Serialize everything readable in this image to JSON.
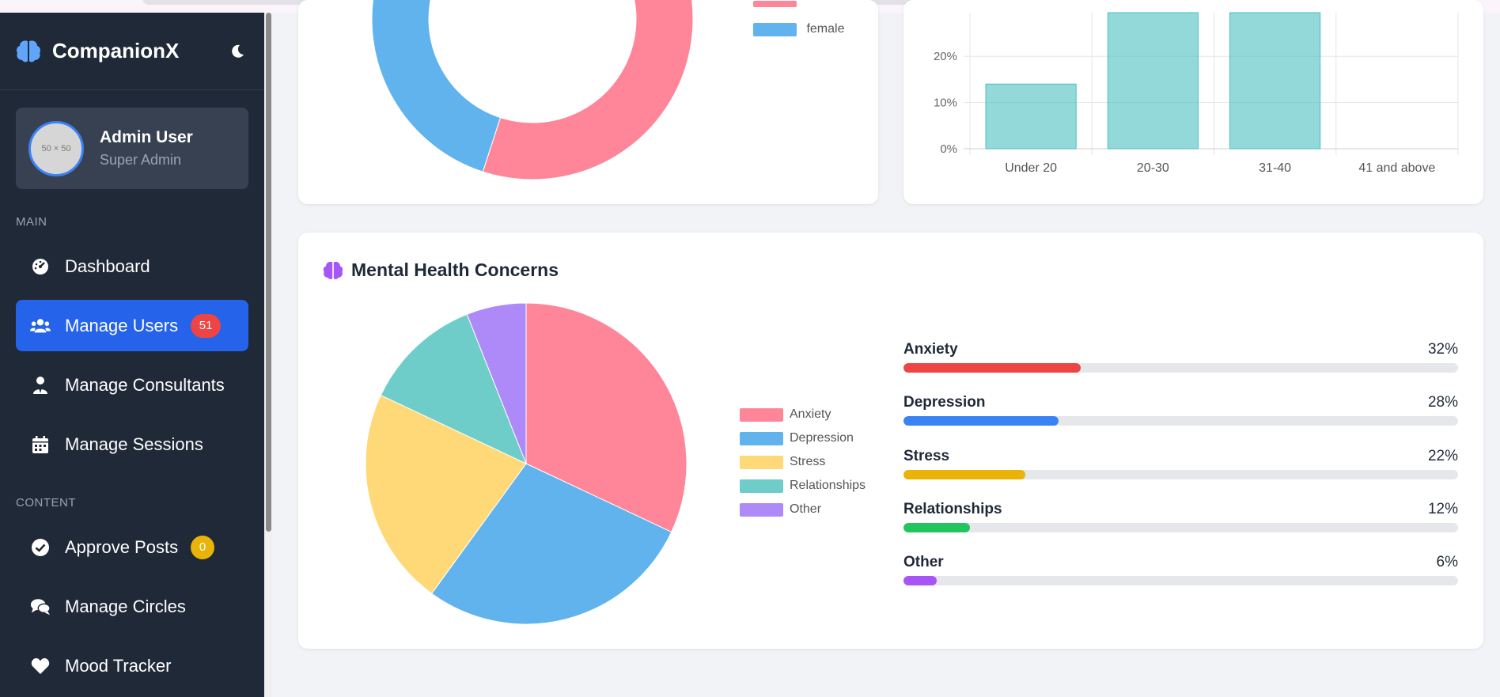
{
  "brand": {
    "name": "CompanionX"
  },
  "profile": {
    "avatar_text": "50 × 50",
    "name": "Admin User",
    "role": "Super Admin"
  },
  "sidebar": {
    "sections": [
      {
        "label": "MAIN"
      },
      {
        "label": "CONTENT"
      }
    ],
    "items": [
      {
        "label": "Dashboard",
        "icon": "tachometer-icon"
      },
      {
        "label": "Manage Users",
        "icon": "users-icon",
        "badge": "51",
        "active": true
      },
      {
        "label": "Manage Consultants",
        "icon": "user-tie-icon"
      },
      {
        "label": "Manage Sessions",
        "icon": "calendar-icon"
      },
      {
        "label": "Approve Posts",
        "icon": "check-circle-icon",
        "badge": "0"
      },
      {
        "label": "Manage Circles",
        "icon": "comments-icon"
      },
      {
        "label": "Mood Tracker",
        "icon": "heart-icon"
      }
    ]
  },
  "gender_chart": {
    "legend": [
      {
        "label": "female",
        "color": "#60b3ec"
      }
    ],
    "colors": {
      "male": "#ff8599",
      "female": "#60b3ec"
    }
  },
  "age_chart": {
    "y_ticks": [
      "0%",
      "10%",
      "20%"
    ],
    "categories": [
      "Under 20",
      "20-30",
      "31-40",
      "41 and above"
    ]
  },
  "concerns": {
    "title": "Mental Health Concerns",
    "items": [
      {
        "label": "Anxiety",
        "percent_text": "32%",
        "value": 32,
        "bar_color": "#ef4444",
        "pie_color": "#ff8599"
      },
      {
        "label": "Depression",
        "percent_text": "28%",
        "value": 28,
        "bar_color": "#3b82f6",
        "pie_color": "#60b3ec"
      },
      {
        "label": "Stress",
        "percent_text": "22%",
        "value": 22,
        "bar_color": "#eab308",
        "pie_color": "#ffd878"
      },
      {
        "label": "Relationships",
        "percent_text": "12%",
        "value": 12,
        "bar_color": "#22c55e",
        "pie_color": "#6fcdc9"
      },
      {
        "label": "Other",
        "percent_text": "6%",
        "value": 6,
        "bar_color": "#a855f7",
        "pie_color": "#ae8af9"
      }
    ]
  },
  "chart_data": [
    {
      "type": "pie",
      "categories": [
        "Anxiety",
        "Depression",
        "Stress",
        "Relationships",
        "Other"
      ],
      "values": [
        32,
        28,
        22,
        12,
        6
      ],
      "title": "Mental Health Concerns",
      "legend": "right"
    },
    {
      "type": "bar",
      "categories": [
        "Under 20",
        "20-30",
        "31-40",
        "41 and above"
      ],
      "values": [
        14,
        null,
        null,
        0
      ],
      "ylabel": "",
      "y_ticks": [
        "0%",
        "10%",
        "20%"
      ],
      "grid": true
    },
    {
      "type": "pie",
      "series": [
        {
          "name": "female"
        }
      ],
      "legend": "right"
    }
  ]
}
